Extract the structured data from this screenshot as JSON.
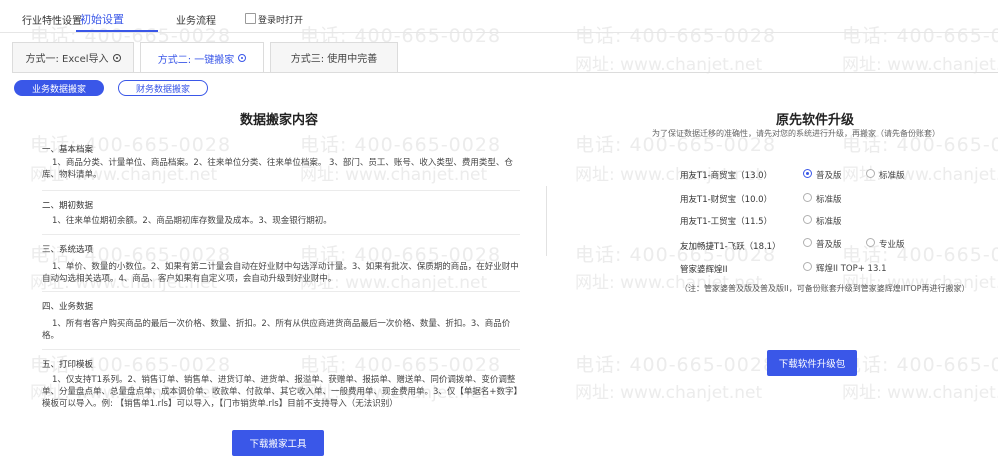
{
  "watermark": {
    "phone": "电话: 400-665-0028",
    "site": "网址: www.chanjet.net"
  },
  "top_tabs": [
    {
      "label": "行业特性设置"
    },
    {
      "label": "初始设置"
    },
    {
      "label": "业务流程"
    }
  ],
  "auto_open": {
    "label": "登录时打开",
    "checked": false
  },
  "method_tabs": [
    {
      "label": "方式一: Excel导入"
    },
    {
      "label": "方式二: 一键搬家"
    },
    {
      "label": "方式三: 使用中完善"
    }
  ],
  "data_tabs": [
    {
      "label": "业务数据搬家"
    },
    {
      "label": "财务数据搬家"
    }
  ],
  "left": {
    "title": "数据搬家内容",
    "sections": [
      {
        "head": "一、基本档案",
        "body": "1、商品分类、计量单位、商品档案。2、往来单位分类、往来单位档案。 3、部门、员工、账号、收入类型、费用类型、仓库、物料清单。"
      },
      {
        "head": "二、期初数据",
        "body": "1、往来单位期初余额。2、商品期初库存数量及成本。3、现金银行期初。"
      },
      {
        "head": "三、系统选项",
        "body": "1、单价、数量的小数位。2、如果有第二计量会自动在好业财中勾选浮动计量。3、如果有批次、保质期的商品，在好业财中自动勾选相关选项。4、商品、客户如果有自定义项，会自动升级到好业财中。"
      },
      {
        "head": "四、业务数据",
        "body": "1、所有者客户购买商品的最后一次价格、数量、折扣。2、所有从供应商进货商品最后一次价格、数量、折扣。3、商品价格。"
      },
      {
        "head": "五、打印模板",
        "body": "1、仅支持T1系列。2、销售订单、销售单、进货订单、进货单、报溢单、获赠单、报损单、赠送单、同价调拨单、变价调整单、分量盘点单、总量盘点单、成本调价单、收款单、付款单、其它收入单、一般费用单、现金费用单。3、仅【单据名+数字】模板可以导入。例: 【销售单1.rls】可以导入，【门市销货单.rls】目前不支持导入（无法识别）"
      }
    ],
    "button": "下载搬家工具"
  },
  "right": {
    "title": "原先软件升级",
    "subtitle": "为了保证数据迁移的准确性，请先对您的系统进行升级，再搬家（请先备份账套）",
    "rows": [
      {
        "label": "用友T1-商贸宝（13.0）",
        "options": [
          {
            "label": "普及版",
            "checked": true
          },
          {
            "label": "标准版",
            "checked": false
          }
        ]
      },
      {
        "label": "用友T1-财贸宝（10.0）",
        "options": [
          {
            "label": "标准版",
            "checked": false
          }
        ]
      },
      {
        "label": "用友T1-工贸宝（11.5）",
        "options": [
          {
            "label": "标准版",
            "checked": false
          }
        ]
      },
      {
        "label": "友加畅捷T1-飞跃（18.1）",
        "options": [
          {
            "label": "普及版",
            "checked": false
          },
          {
            "label": "专业版",
            "checked": false
          }
        ]
      },
      {
        "label": "管家婆辉煌II",
        "options": [
          {
            "label": "辉煌II TOP+ 13.1",
            "checked": false
          }
        ]
      }
    ],
    "note": "（注：管家婆普及版及普及版II，可备份账套升级到管家婆辉煌IITOP再进行搬家）",
    "button": "下载软件升级包"
  },
  "colors": {
    "accent": "#3a57e8"
  }
}
